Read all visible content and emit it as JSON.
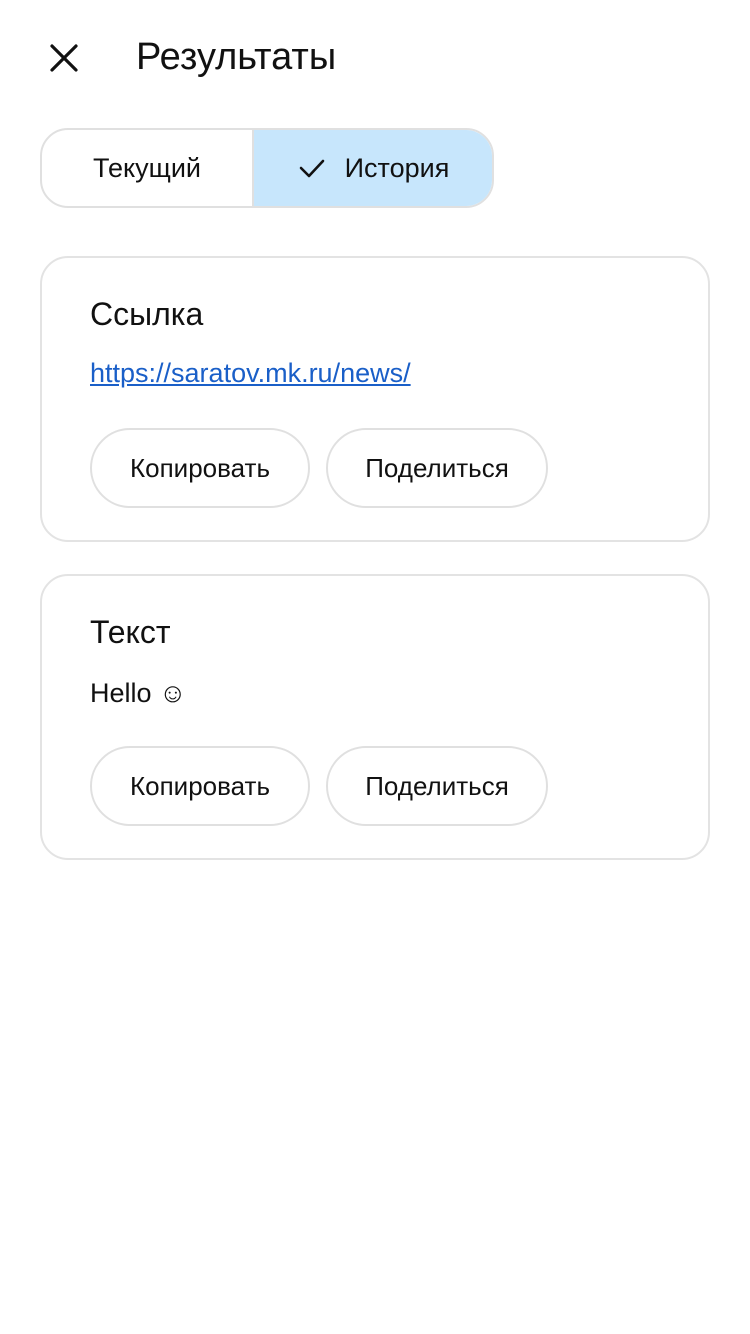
{
  "header": {
    "title": "Результаты",
    "close_icon": "close-icon"
  },
  "tabs": [
    {
      "label": "Текущий",
      "selected": false
    },
    {
      "label": "История",
      "selected": true,
      "icon": "check-icon"
    }
  ],
  "colors": {
    "selected_tab_bg": "#c7e6fc",
    "link": "#1a5fc8",
    "border": "#e0e0e0"
  },
  "cards": [
    {
      "title": "Ссылка",
      "content": "https://saratov.mk.ru/news/",
      "copy_label": "Копировать",
      "share_label": "Поделиться"
    },
    {
      "title": "Текст",
      "content": "Hello ☺",
      "copy_label": "Копировать",
      "share_label": "Поделиться"
    }
  ]
}
